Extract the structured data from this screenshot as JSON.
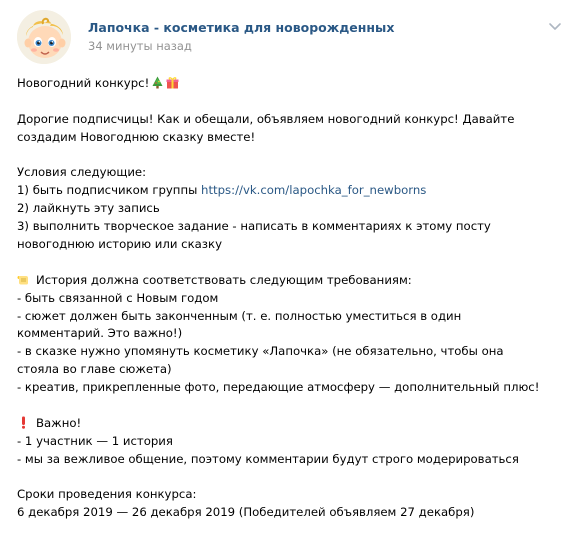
{
  "post": {
    "author": "Лапочка - косметика для новорожденных",
    "time": "34 минуты назад",
    "menu_icon": "chevron-down-icon"
  },
  "body": {
    "title": "Новогодний конкурс!",
    "title_emojis": [
      "christmas-tree-icon",
      "gift-icon"
    ],
    "intro_1": "Дорогие подписчицы! Как и обещали, объявляем новогодний конкурс! Давайте",
    "intro_2": "создадим Новогоднюю сказку вместе!",
    "conditions_title": "Условия следующие:",
    "condition_1_prefix": "1) быть подписчиком группы ",
    "condition_1_link": "https://vk.com/lapochka_for_newborns",
    "condition_2": "2) лайкнуть эту запись",
    "condition_3a": "3) выполнить творческое задание - написать в комментариях к этому посту",
    "condition_3b": "новогоднюю историю или сказку",
    "requirements_title": "История должна соответствовать следующим требованиям:",
    "req_1": "- быть связанной с Новым годом",
    "req_2a": "- сюжет должен быть законченным (т. е. полностью уместиться в один",
    "req_2b": "комментарий. Это важно!)",
    "req_3a": "- в сказке нужно упомянуть косметику «Лапочка» (не обязательно, чтобы она",
    "req_3b": "стояла во главе сюжета)",
    "req_4": "- креатив, прикрепленные фото, передающие атмосферу — дополнительный плюс!",
    "important_title": "Важно!",
    "imp_1": "- 1 участник — 1 история",
    "imp_2": "- мы за вежливое общение, поэтому комментарии будут строго модерироваться",
    "dates_title": "Сроки проведения конкурса:",
    "dates": "6 декабря 2019 — 26 декабря 2019 (Победителей объявляем 27 декабря)"
  },
  "colors": {
    "link": "#2a5885",
    "secondary_text": "#939393",
    "text": "#000000"
  }
}
